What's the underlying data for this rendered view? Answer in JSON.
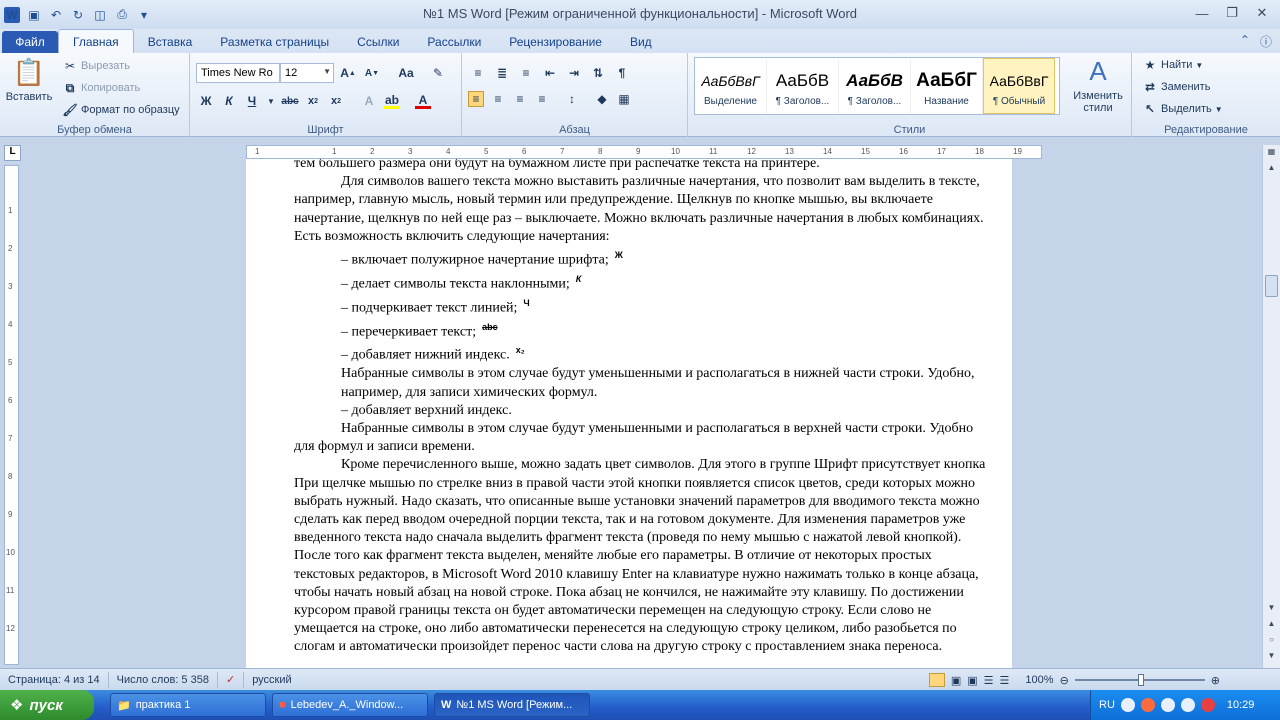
{
  "window": {
    "title": "№1 MS Word [Режим ограниченной функциональности]  -  Microsoft Word"
  },
  "tabs": [
    "Файл",
    "Главная",
    "Вставка",
    "Разметка страницы",
    "Ссылки",
    "Рассылки",
    "Рецензирование",
    "Вид"
  ],
  "clipboard": {
    "paste": "Вставить",
    "cut": "Вырезать",
    "copy": "Копировать",
    "format_painter": "Формат по образцу",
    "label": "Буфер обмена"
  },
  "font": {
    "name": "Times New Ro",
    "size": "12",
    "label": "Шрифт"
  },
  "paragraph": {
    "label": "Абзац"
  },
  "styles": {
    "label": "Стили",
    "items": [
      {
        "preview": "АаБбВвГ",
        "name": "Выделение"
      },
      {
        "preview": "АаБбВ",
        "name": "¶ Заголов..."
      },
      {
        "preview": "АаБбВ",
        "name": "¶ Заголов..."
      },
      {
        "preview": "АаБбГ",
        "name": "Название"
      },
      {
        "preview": "АаБбВвГ",
        "name": "¶ Обычный"
      }
    ],
    "change": "Изменить стили"
  },
  "editing": {
    "find": "Найти",
    "replace": "Заменить",
    "select": "Выделить",
    "label": "Редактирование"
  },
  "document": {
    "top_line": "тем большего размера они будут на бумажном листе при распечатке текста на принтере.",
    "para1": "Для символов вашего текста можно выставить различные начертания, что позволит вам выделить в тексте, например, главную мысль, новый термин или предупреждение. Щелкнув по кнопке мышью, вы включаете начертание, щелкнув по ней еще раз – выключаете. Можно включать различные начертания в любых комбинациях. Есть возможность включить следующие начертания:",
    "list": [
      {
        "text": "– включает полужирное начертание шрифта;",
        "glyph": "Ж"
      },
      {
        "text": "– делает символы текста наклонными;",
        "glyph": "К"
      },
      {
        "text": "– подчеркивает текст линией;",
        "glyph": "Ч"
      },
      {
        "text": "– перечеркивает текст;",
        "glyph": "abc"
      },
      {
        "text": "– добавляет нижний индекс.",
        "glyph": "x₂"
      }
    ],
    "para2": "Набранные символы в этом случае будут уменьшенными и располагаться в нижней части строки. Удобно, например, для записи химических формул.",
    "list2": "– добавляет верхний индекс.",
    "para3": "Набранные символы в этом случае будут уменьшенными и располагаться в верхней части строки. Удобно для формул и записи времени.",
    "para4": "Кроме перечисленного выше, можно задать цвет символов. Для этого в группе Шрифт присутствует кнопка При щелчке мышью по стрелке вниз в правой части этой кнопки появляется список цветов, среди которых можно выбрать нужный. Надо сказать, что описанные выше установки значений параметров для вводимого текста можно сделать как перед вводом очередной порции текста, так и на готовом документе. Для изменения параметров уже введенного текста надо сначала выделить фрагмент текста (проведя по нему мышью с нажатой левой кнопкой). После того как фрагмент текста выделен, меняйте любые его параметры. В отличие от некоторых простых текстовых редакторов, в Microsoft Word 2010 клавишу Enter на клавиатуре нужно нажимать только в конце абзаца, чтобы начать новый абзац на новой строке. Пока абзац не кончился, не нажимайте эту клавишу. По достижении курсором правой границы текста он будет автоматически перемещен на следующую строку. Если слово не умещается на строке, оно либо автоматически перенесется на следующую строку целиком, либо разобьется по слогам и автоматически произойдет перенос части слова на другую строку с проставлением знака переноса."
  },
  "status": {
    "page": "Страница: 4 из 14",
    "words": "Число слов: 5 358",
    "lang": "русский",
    "zoom": "100%"
  },
  "taskbar": {
    "start": "пуск",
    "items": [
      "практика 1",
      "Lebedev_A._Window...",
      "№1 MS Word [Режим..."
    ],
    "lang": "RU",
    "time": "10:29"
  }
}
